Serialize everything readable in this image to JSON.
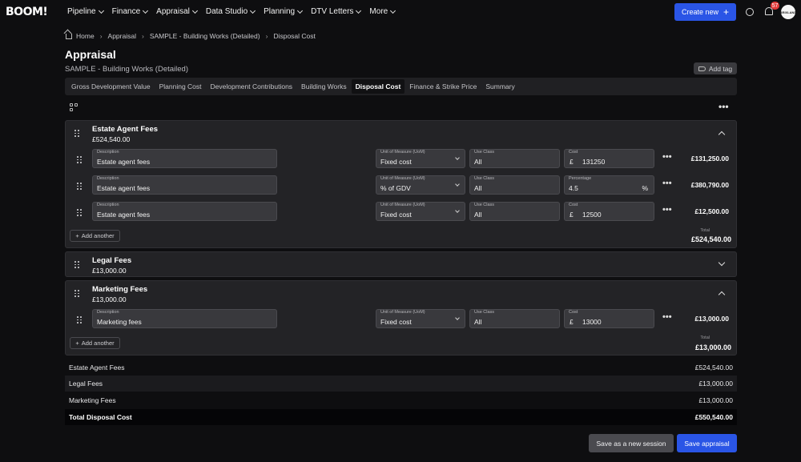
{
  "nav": {
    "logo": "BOOM!",
    "items": [
      "Pipeline",
      "Finance",
      "Appraisal",
      "Data Studio",
      "Planning",
      "DTV Letters",
      "More"
    ],
    "create_label": "Create new",
    "notification_count": "57",
    "avatar_text": "BRIXLAND"
  },
  "breadcrumb": [
    "Home",
    "Appraisal",
    "SAMPLE - Building Works (Detailed)",
    "Disposal Cost"
  ],
  "page": {
    "title": "Appraisal",
    "subtitle": "SAMPLE - Building Works (Detailed)",
    "add_tag_label": "Add tag"
  },
  "tabs": [
    {
      "label": "Gross Development Value",
      "active": false
    },
    {
      "label": "Planning Cost",
      "active": false
    },
    {
      "label": "Development Contributions",
      "active": false
    },
    {
      "label": "Building Works",
      "active": false
    },
    {
      "label": "Disposal Cost",
      "active": true
    },
    {
      "label": "Finance & Strike Price",
      "active": false
    },
    {
      "label": "Summary",
      "active": false
    }
  ],
  "labels": {
    "description": "Description",
    "uom": "Unit of Measure (UoM)",
    "use_class": "Use Class",
    "cost": "Cost",
    "percentage": "Percentage",
    "add_another": "Add another",
    "total": "Total",
    "currency": "£",
    "percent": "%"
  },
  "sections": {
    "estate": {
      "title": "Estate Agent Fees",
      "amount": "£524,540.00",
      "total": "£524,540.00",
      "rows": [
        {
          "description": "Estate agent fees",
          "uom": "Fixed cost",
          "use_class": "All",
          "value": "131250",
          "total": "£131,250.00"
        },
        {
          "description": "Estate agent fees",
          "uom": "% of GDV",
          "use_class": "All",
          "value": "4.5",
          "total": "£380,790.00"
        },
        {
          "description": "Estate agent fees",
          "uom": "Fixed cost",
          "use_class": "All",
          "value": "12500",
          "total": "£12,500.00"
        }
      ]
    },
    "legal": {
      "title": "Legal Fees",
      "amount": "£13,000.00"
    },
    "marketing": {
      "title": "Marketing Fees",
      "amount": "£13,000.00",
      "total": "£13,000.00",
      "rows": [
        {
          "description": "Marketing fees",
          "uom": "Fixed cost",
          "use_class": "All",
          "value": "13000",
          "total": "£13,000.00"
        }
      ]
    }
  },
  "summary": [
    {
      "label": "Estate Agent Fees",
      "value": "£524,540.00"
    },
    {
      "label": "Legal Fees",
      "value": "£13,000.00"
    },
    {
      "label": "Marketing Fees",
      "value": "£13,000.00"
    },
    {
      "label": "Total Disposal Cost",
      "value": "£550,540.00"
    }
  ],
  "actions": {
    "save_session": "Save as a new session",
    "save_appraisal": "Save appraisal"
  },
  "colors": {
    "accent": "#2a55e6",
    "badge": "#e23a3a"
  }
}
